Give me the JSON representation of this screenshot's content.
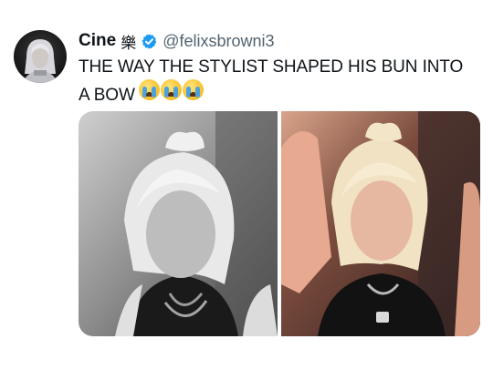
{
  "tweet": {
    "author": {
      "display_name": "Cine",
      "name_suffix": "樂",
      "verified": true,
      "verified_color": "#1d9bf0",
      "handle": "@felixsbrowni3",
      "avatar_icon": "profile-photo"
    },
    "text": "THE WAY THE STYLIST SHAPED HIS BUN INTO A BOW",
    "emojis": [
      "loudly-crying-face",
      "loudly-crying-face",
      "loudly-crying-face"
    ],
    "media": [
      {
        "name": "photo-bw",
        "tone": "grayscale"
      },
      {
        "name": "photo-color",
        "tone": "color"
      }
    ]
  }
}
